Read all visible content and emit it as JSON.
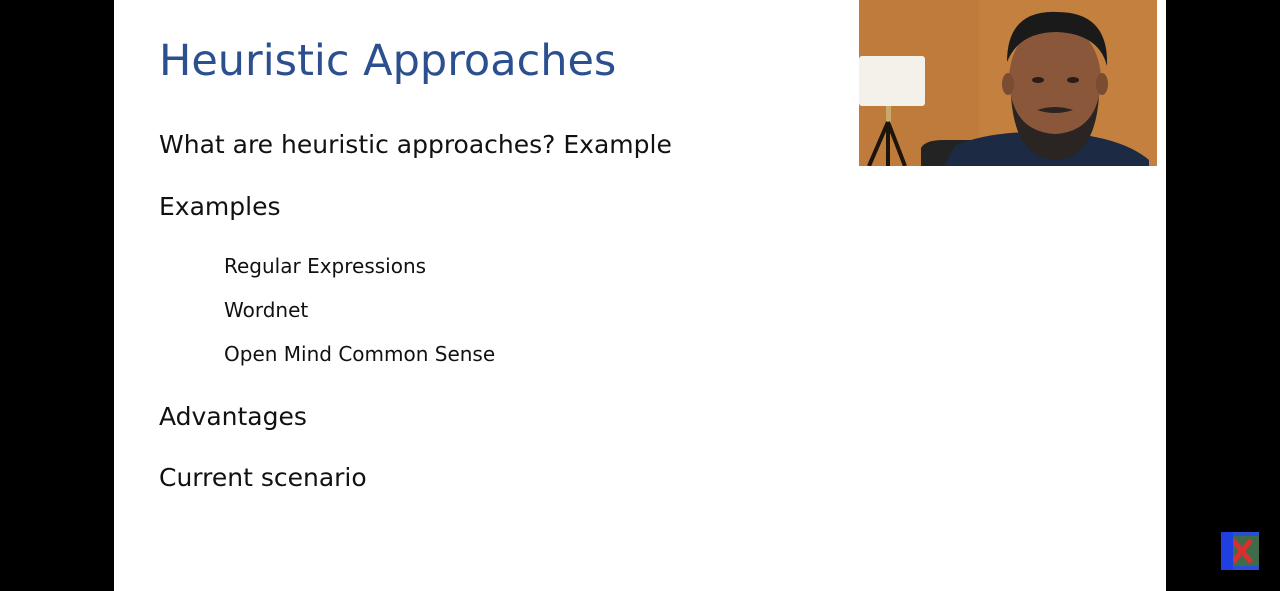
{
  "slide": {
    "title": "Heuristic Approaches",
    "bullets": [
      {
        "text": "What are heuristic approaches? Example",
        "level": 1
      },
      {
        "text": "Examples",
        "level": 1
      },
      {
        "text": "Regular Expressions",
        "level": 2
      },
      {
        "text": "Wordnet",
        "level": 2
      },
      {
        "text": "Open Mind Common Sense",
        "level": 2
      },
      {
        "text": "Advantages",
        "level": 1
      },
      {
        "text": "Current scenario",
        "level": 1
      }
    ]
  },
  "colors": {
    "title": "#2b4f8f",
    "body_text": "#111111",
    "slide_background": "#ffffff",
    "letterbox": "#000000"
  },
  "webcam": {
    "icon": "presenter-video-feed"
  },
  "corner_logo": {
    "icon": "channel-logo-icon"
  }
}
